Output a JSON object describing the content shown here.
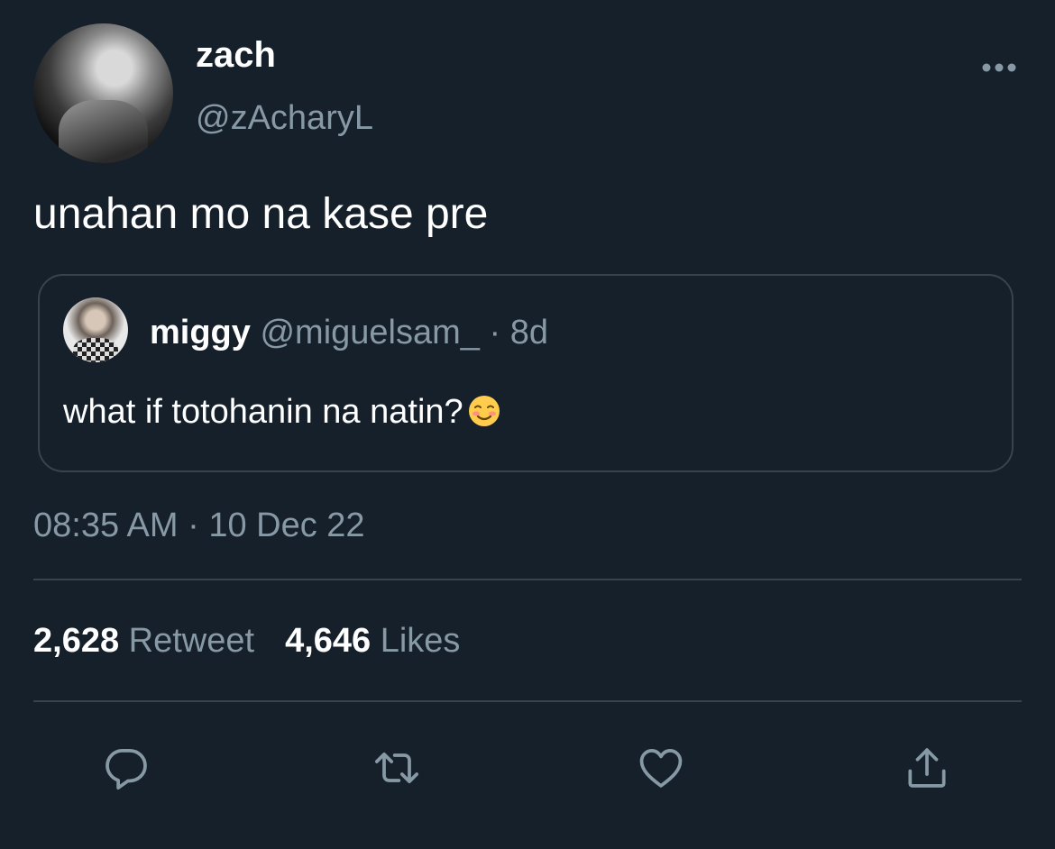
{
  "tweet": {
    "display_name": "zach",
    "handle": "@zAcharyL",
    "text": "unahan mo na kase pre",
    "timestamp": "08:35 AM · 10 Dec 22",
    "more_icon": "more-horizontal-icon"
  },
  "quote": {
    "display_name": "miggy",
    "handle": "@miguelsam_",
    "separator": "·",
    "time": "8d",
    "text": "what if totohanin na natin?",
    "emoji": "smiling-face-icon"
  },
  "stats": {
    "retweets_count": "2,628",
    "retweets_label": "Retweet",
    "likes_count": "4,646",
    "likes_label": "Likes"
  },
  "actions": {
    "reply_icon": "reply-icon",
    "retweet_icon": "retweet-icon",
    "like_icon": "heart-icon",
    "share_icon": "share-icon"
  },
  "colors": {
    "background": "#15202b",
    "text_primary": "#ffffff",
    "text_secondary": "#8899a6",
    "border": "#38444d"
  }
}
